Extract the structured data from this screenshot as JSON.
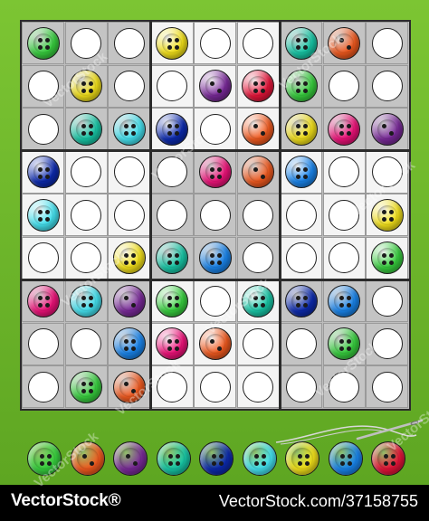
{
  "colors": {
    "lime": "#38d13f",
    "orange": "#f25a1f",
    "purple": "#7b2a9b",
    "teal": "#18c9a8",
    "navy": "#0d2bb0",
    "pink": "#f0127a",
    "yellow": "#f4e21a",
    "blue": "#1a86ee",
    "red": "#e8153a",
    "cyan": "#45e4f2"
  },
  "grid": [
    [
      "lime",
      null,
      null,
      "yellow",
      null,
      null,
      "teal",
      "orange",
      null
    ],
    [
      null,
      "yellow",
      null,
      null,
      "purple",
      "red",
      "lime",
      null,
      null
    ],
    [
      null,
      "teal",
      "cyan",
      "navy",
      null,
      "orange",
      "yellow",
      "pink",
      "purple"
    ],
    [
      "navy",
      null,
      null,
      null,
      "pink",
      "orange",
      "blue",
      null,
      null
    ],
    [
      "cyan",
      null,
      null,
      null,
      null,
      null,
      null,
      null,
      "yellow"
    ],
    [
      null,
      null,
      "yellow",
      "teal",
      "blue",
      null,
      null,
      null,
      "lime"
    ],
    [
      "pink",
      "cyan",
      "purple",
      "lime",
      null,
      "teal",
      "navy",
      "blue",
      null
    ],
    [
      null,
      null,
      "blue",
      "pink",
      "orange",
      null,
      null,
      "lime",
      null
    ],
    [
      null,
      "lime",
      "orange",
      null,
      null,
      null,
      null,
      null,
      null
    ]
  ],
  "palette": [
    "lime",
    "orange",
    "purple",
    "teal",
    "navy",
    "cyan",
    "yellow",
    "blue",
    "red"
  ],
  "footer": {
    "brand": "VectorStock®",
    "image_id": "VectorStock.com/37158755"
  },
  "watermark": "VectorStock"
}
